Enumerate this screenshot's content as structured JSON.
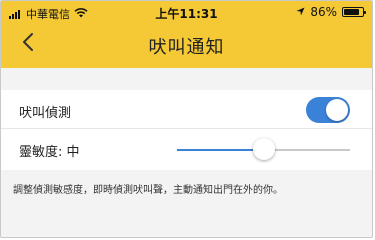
{
  "status_bar": {
    "carrier": "中華電信",
    "time": "上午11:31",
    "battery_text": "86%",
    "battery_level": 0.86
  },
  "nav": {
    "title": "吠叫通知",
    "back_icon": "chevron-left-icon"
  },
  "settings": {
    "bark_detection": {
      "label": "吠叫偵測",
      "enabled": true
    },
    "sensitivity": {
      "label": "靈敏度: 中",
      "value_fraction": 0.5
    }
  },
  "footer": {
    "note": "調整偵測敏感度，即時偵測吠叫聲，主動通知出門在外的你。"
  },
  "colors": {
    "header": "#f5c935",
    "accent": "#3a81d8",
    "background": "#f3f3f3"
  }
}
